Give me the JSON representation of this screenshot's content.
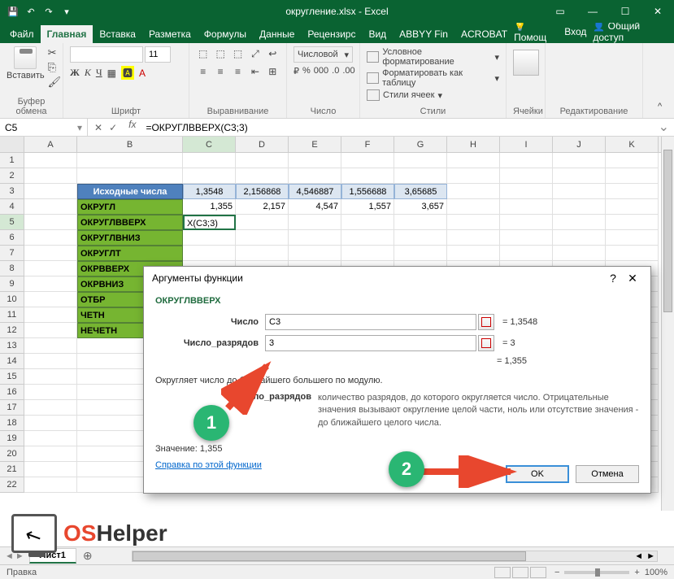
{
  "titlebar": {
    "title": "округление.xlsx - Excel"
  },
  "tabs": {
    "file": "Файл",
    "items": [
      "Главная",
      "Вставка",
      "Разметка",
      "Формулы",
      "Данные",
      "Рецензирс",
      "Вид",
      "ABBYY Fin",
      "ACROBAT"
    ],
    "active_index": 0,
    "help": "Помощ",
    "login": "Вход",
    "share": "Общий доступ"
  },
  "ribbon": {
    "clipboard": {
      "paste": "Вставить",
      "label": "Буфер обмена"
    },
    "font": {
      "name": "",
      "size": "11",
      "label": "Шрифт"
    },
    "alignment": {
      "label": "Выравнивание"
    },
    "number": {
      "format": "Числовой",
      "label": "Число"
    },
    "styles": {
      "cond": "Условное форматирование",
      "table": "Форматировать как таблицу",
      "cell": "Стили ячеек",
      "label": "Стили"
    },
    "cells": {
      "label": "Ячейки"
    },
    "editing": {
      "label": "Редактирование"
    }
  },
  "namebox": "C5",
  "formula": "=ОКРУГЛВВЕРХ(C3;3)",
  "columns": [
    "A",
    "B",
    "C",
    "D",
    "E",
    "F",
    "G",
    "H",
    "I",
    "J",
    "K"
  ],
  "rows": [
    "1",
    "2",
    "3",
    "4",
    "5",
    "6",
    "7",
    "8",
    "9",
    "10",
    "11",
    "12",
    "13",
    "14",
    "15",
    "16",
    "17",
    "18",
    "19",
    "20",
    "21",
    "22"
  ],
  "table": {
    "header_b": "Исходные числа",
    "r3": [
      "1,3548",
      "2,156868",
      "4,546887",
      "1,556688",
      "3,65685"
    ],
    "r4_b": "ОКРУГЛ",
    "r4": [
      "1,355",
      "2,157",
      "4,547",
      "1,557",
      "3,657"
    ],
    "r5_b": "ОКРУГЛВВЕРХ",
    "r5_c": "X(C3;3)",
    "r6_b": "ОКРУГЛВНИЗ",
    "r7_b": "ОКРУГЛТ",
    "r8_b": "ОКРВВЕРХ",
    "r9_b": "ОКРВНИЗ",
    "r10_b": "ОТБР",
    "r11_b": "ЧЕТН",
    "r12_b": "НЕЧЕТН"
  },
  "dialog": {
    "title": "Аргументы функции",
    "func": "ОКРУГЛВВЕРХ",
    "arg1_label": "Число",
    "arg1_val": "C3",
    "arg1_res": "= 1,3548",
    "arg2_label": "Число_разрядов",
    "arg2_val": "3",
    "arg2_res": "= 3",
    "calc_res": "= 1,355",
    "desc": "Округляет число до ближайшего большего по модулю.",
    "arg_name": "Число_разрядов",
    "arg_desc": "количество разрядов, до которого округляется число. Отрицательные значения вызывают округление целой части, ноль или отсутствие значения - до ближайшего целого числа.",
    "value_label": "Значение:",
    "value": "1,355",
    "help": "Справка по этой функции",
    "ok": "OK",
    "cancel": "Отмена"
  },
  "sheet_tab": "Лист1",
  "status": {
    "mode": "Правка",
    "zoom": "100%"
  },
  "logo": {
    "os": "OS",
    "helper": "Helper"
  },
  "badges": {
    "b1": "1",
    "b2": "2"
  }
}
